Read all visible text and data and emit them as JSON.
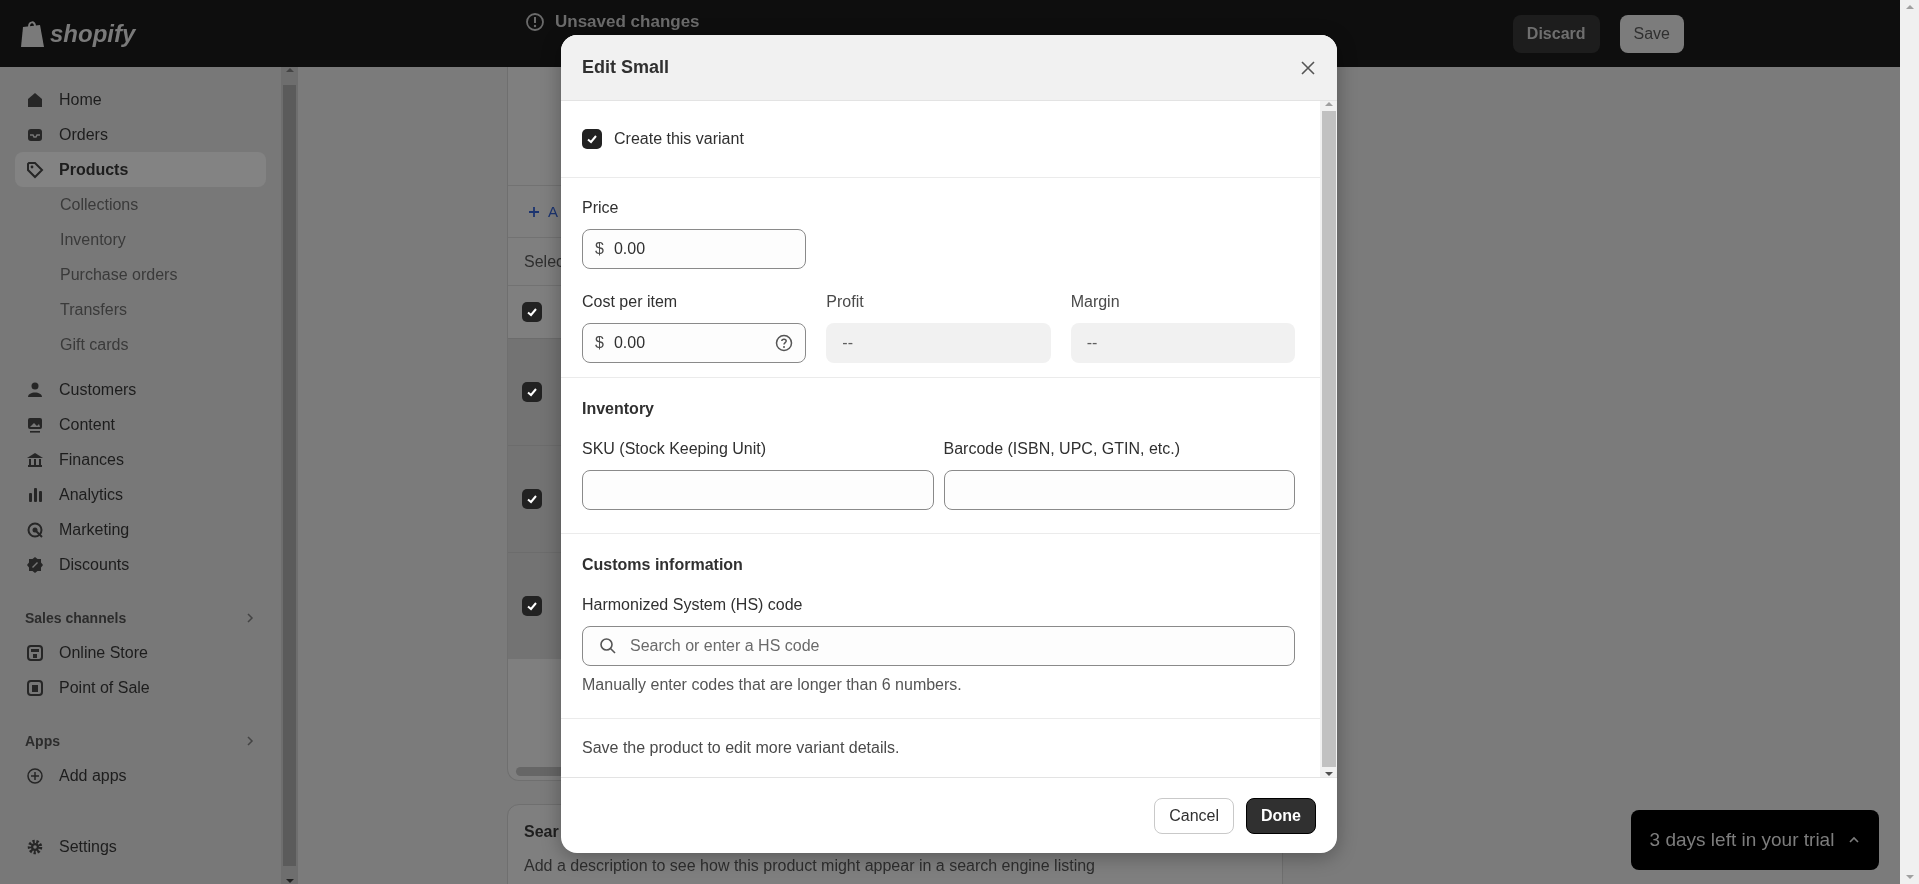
{
  "top_bar": {
    "logo": "shopify",
    "status": "Unsaved changes",
    "buttons": [
      {
        "label": "Discard",
        "kind": "secondary"
      },
      {
        "label": "Save",
        "kind": "primary"
      }
    ]
  },
  "sidebar": {
    "items": [
      {
        "label": "Home",
        "selected": false
      },
      {
        "label": "Orders",
        "selected": false
      },
      {
        "label": "Products",
        "selected": true,
        "children": [
          {
            "label": "Collections",
            "selected": false
          },
          {
            "label": "Inventory",
            "selected": false
          },
          {
            "label": "Purchase orders",
            "selected": false
          },
          {
            "label": "Transfers",
            "selected": false
          },
          {
            "label": "Gift cards",
            "selected": false
          }
        ]
      },
      {
        "label": "Customers",
        "selected": false
      },
      {
        "label": "Content",
        "selected": false
      },
      {
        "label": "Finances",
        "selected": false
      },
      {
        "label": "Analytics",
        "selected": false
      },
      {
        "label": "Marketing",
        "selected": false
      },
      {
        "label": "Discounts",
        "selected": false
      }
    ],
    "sections": [
      {
        "title": "Sales channels",
        "items": [
          {
            "label": "Online Store",
            "selected": false
          },
          {
            "label": "Point of Sale",
            "selected": false
          }
        ]
      },
      {
        "title": "Apps",
        "items": [
          {
            "label": "Add apps",
            "selected": false
          }
        ]
      }
    ],
    "footer_item": {
      "label": "Settings",
      "selected": false
    }
  },
  "variants_card": {
    "add_link": "A",
    "select_label": "Selec",
    "header_checked": true,
    "rows": [
      {
        "checked": true
      },
      {
        "checked": true
      },
      {
        "checked": true
      }
    ]
  },
  "seo_card": {
    "title": "Sear",
    "description": "Add a description to see how this product might appear in a search engine listing"
  },
  "modal": {
    "title": "Edit Small",
    "create_variant": {
      "label": "Create this variant",
      "checked": true
    },
    "price": {
      "label": "Price",
      "prefix": "$",
      "value": "0.00"
    },
    "cost": {
      "label": "Cost per item",
      "prefix": "$",
      "value": "0.00"
    },
    "profit": {
      "label": "Profit",
      "value": "--"
    },
    "margin": {
      "label": "Margin",
      "value": "--"
    },
    "inventory": {
      "heading": "Inventory",
      "sku": {
        "label": "SKU (Stock Keeping Unit)"
      },
      "barcode": {
        "label": "Barcode (ISBN, UPC, GTIN, etc.)"
      }
    },
    "customs": {
      "heading": "Customs information",
      "hs_code": {
        "label": "Harmonized System (HS) code",
        "placeholder": "Search or enter a HS code"
      },
      "help_text": "Manually enter codes that are longer than 6 numbers."
    },
    "note": "Save the product to edit more variant details.",
    "buttons": [
      {
        "label": "Cancel",
        "kind": "secondary"
      },
      {
        "label": "Done",
        "kind": "primary"
      }
    ]
  },
  "trial_banner": {
    "text": "3 days left in your trial"
  }
}
